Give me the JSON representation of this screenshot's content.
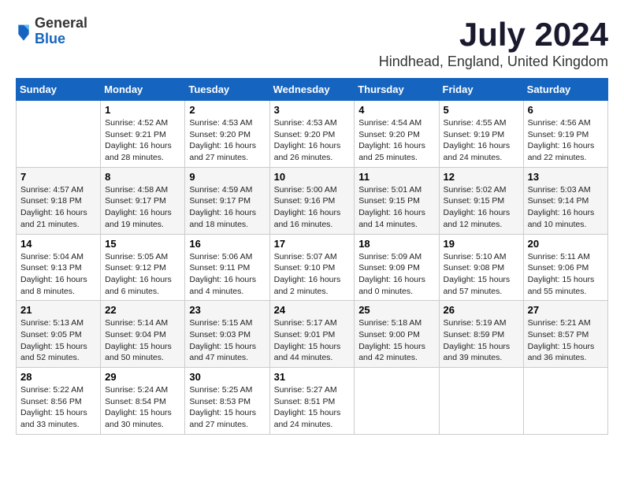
{
  "header": {
    "logo_general": "General",
    "logo_blue": "Blue",
    "month_title": "July 2024",
    "location": "Hindhead, England, United Kingdom"
  },
  "days_of_week": [
    "Sunday",
    "Monday",
    "Tuesday",
    "Wednesday",
    "Thursday",
    "Friday",
    "Saturday"
  ],
  "weeks": [
    [
      {
        "day": "",
        "content": ""
      },
      {
        "day": "1",
        "content": "Sunrise: 4:52 AM\nSunset: 9:21 PM\nDaylight: 16 hours\nand 28 minutes."
      },
      {
        "day": "2",
        "content": "Sunrise: 4:53 AM\nSunset: 9:20 PM\nDaylight: 16 hours\nand 27 minutes."
      },
      {
        "day": "3",
        "content": "Sunrise: 4:53 AM\nSunset: 9:20 PM\nDaylight: 16 hours\nand 26 minutes."
      },
      {
        "day": "4",
        "content": "Sunrise: 4:54 AM\nSunset: 9:20 PM\nDaylight: 16 hours\nand 25 minutes."
      },
      {
        "day": "5",
        "content": "Sunrise: 4:55 AM\nSunset: 9:19 PM\nDaylight: 16 hours\nand 24 minutes."
      },
      {
        "day": "6",
        "content": "Sunrise: 4:56 AM\nSunset: 9:19 PM\nDaylight: 16 hours\nand 22 minutes."
      }
    ],
    [
      {
        "day": "7",
        "content": "Sunrise: 4:57 AM\nSunset: 9:18 PM\nDaylight: 16 hours\nand 21 minutes."
      },
      {
        "day": "8",
        "content": "Sunrise: 4:58 AM\nSunset: 9:17 PM\nDaylight: 16 hours\nand 19 minutes."
      },
      {
        "day": "9",
        "content": "Sunrise: 4:59 AM\nSunset: 9:17 PM\nDaylight: 16 hours\nand 18 minutes."
      },
      {
        "day": "10",
        "content": "Sunrise: 5:00 AM\nSunset: 9:16 PM\nDaylight: 16 hours\nand 16 minutes."
      },
      {
        "day": "11",
        "content": "Sunrise: 5:01 AM\nSunset: 9:15 PM\nDaylight: 16 hours\nand 14 minutes."
      },
      {
        "day": "12",
        "content": "Sunrise: 5:02 AM\nSunset: 9:15 PM\nDaylight: 16 hours\nand 12 minutes."
      },
      {
        "day": "13",
        "content": "Sunrise: 5:03 AM\nSunset: 9:14 PM\nDaylight: 16 hours\nand 10 minutes."
      }
    ],
    [
      {
        "day": "14",
        "content": "Sunrise: 5:04 AM\nSunset: 9:13 PM\nDaylight: 16 hours\nand 8 minutes."
      },
      {
        "day": "15",
        "content": "Sunrise: 5:05 AM\nSunset: 9:12 PM\nDaylight: 16 hours\nand 6 minutes."
      },
      {
        "day": "16",
        "content": "Sunrise: 5:06 AM\nSunset: 9:11 PM\nDaylight: 16 hours\nand 4 minutes."
      },
      {
        "day": "17",
        "content": "Sunrise: 5:07 AM\nSunset: 9:10 PM\nDaylight: 16 hours\nand 2 minutes."
      },
      {
        "day": "18",
        "content": "Sunrise: 5:09 AM\nSunset: 9:09 PM\nDaylight: 16 hours\nand 0 minutes."
      },
      {
        "day": "19",
        "content": "Sunrise: 5:10 AM\nSunset: 9:08 PM\nDaylight: 15 hours\nand 57 minutes."
      },
      {
        "day": "20",
        "content": "Sunrise: 5:11 AM\nSunset: 9:06 PM\nDaylight: 15 hours\nand 55 minutes."
      }
    ],
    [
      {
        "day": "21",
        "content": "Sunrise: 5:13 AM\nSunset: 9:05 PM\nDaylight: 15 hours\nand 52 minutes."
      },
      {
        "day": "22",
        "content": "Sunrise: 5:14 AM\nSunset: 9:04 PM\nDaylight: 15 hours\nand 50 minutes."
      },
      {
        "day": "23",
        "content": "Sunrise: 5:15 AM\nSunset: 9:03 PM\nDaylight: 15 hours\nand 47 minutes."
      },
      {
        "day": "24",
        "content": "Sunrise: 5:17 AM\nSunset: 9:01 PM\nDaylight: 15 hours\nand 44 minutes."
      },
      {
        "day": "25",
        "content": "Sunrise: 5:18 AM\nSunset: 9:00 PM\nDaylight: 15 hours\nand 42 minutes."
      },
      {
        "day": "26",
        "content": "Sunrise: 5:19 AM\nSunset: 8:59 PM\nDaylight: 15 hours\nand 39 minutes."
      },
      {
        "day": "27",
        "content": "Sunrise: 5:21 AM\nSunset: 8:57 PM\nDaylight: 15 hours\nand 36 minutes."
      }
    ],
    [
      {
        "day": "28",
        "content": "Sunrise: 5:22 AM\nSunset: 8:56 PM\nDaylight: 15 hours\nand 33 minutes."
      },
      {
        "day": "29",
        "content": "Sunrise: 5:24 AM\nSunset: 8:54 PM\nDaylight: 15 hours\nand 30 minutes."
      },
      {
        "day": "30",
        "content": "Sunrise: 5:25 AM\nSunset: 8:53 PM\nDaylight: 15 hours\nand 27 minutes."
      },
      {
        "day": "31",
        "content": "Sunrise: 5:27 AM\nSunset: 8:51 PM\nDaylight: 15 hours\nand 24 minutes."
      },
      {
        "day": "",
        "content": ""
      },
      {
        "day": "",
        "content": ""
      },
      {
        "day": "",
        "content": ""
      }
    ]
  ]
}
